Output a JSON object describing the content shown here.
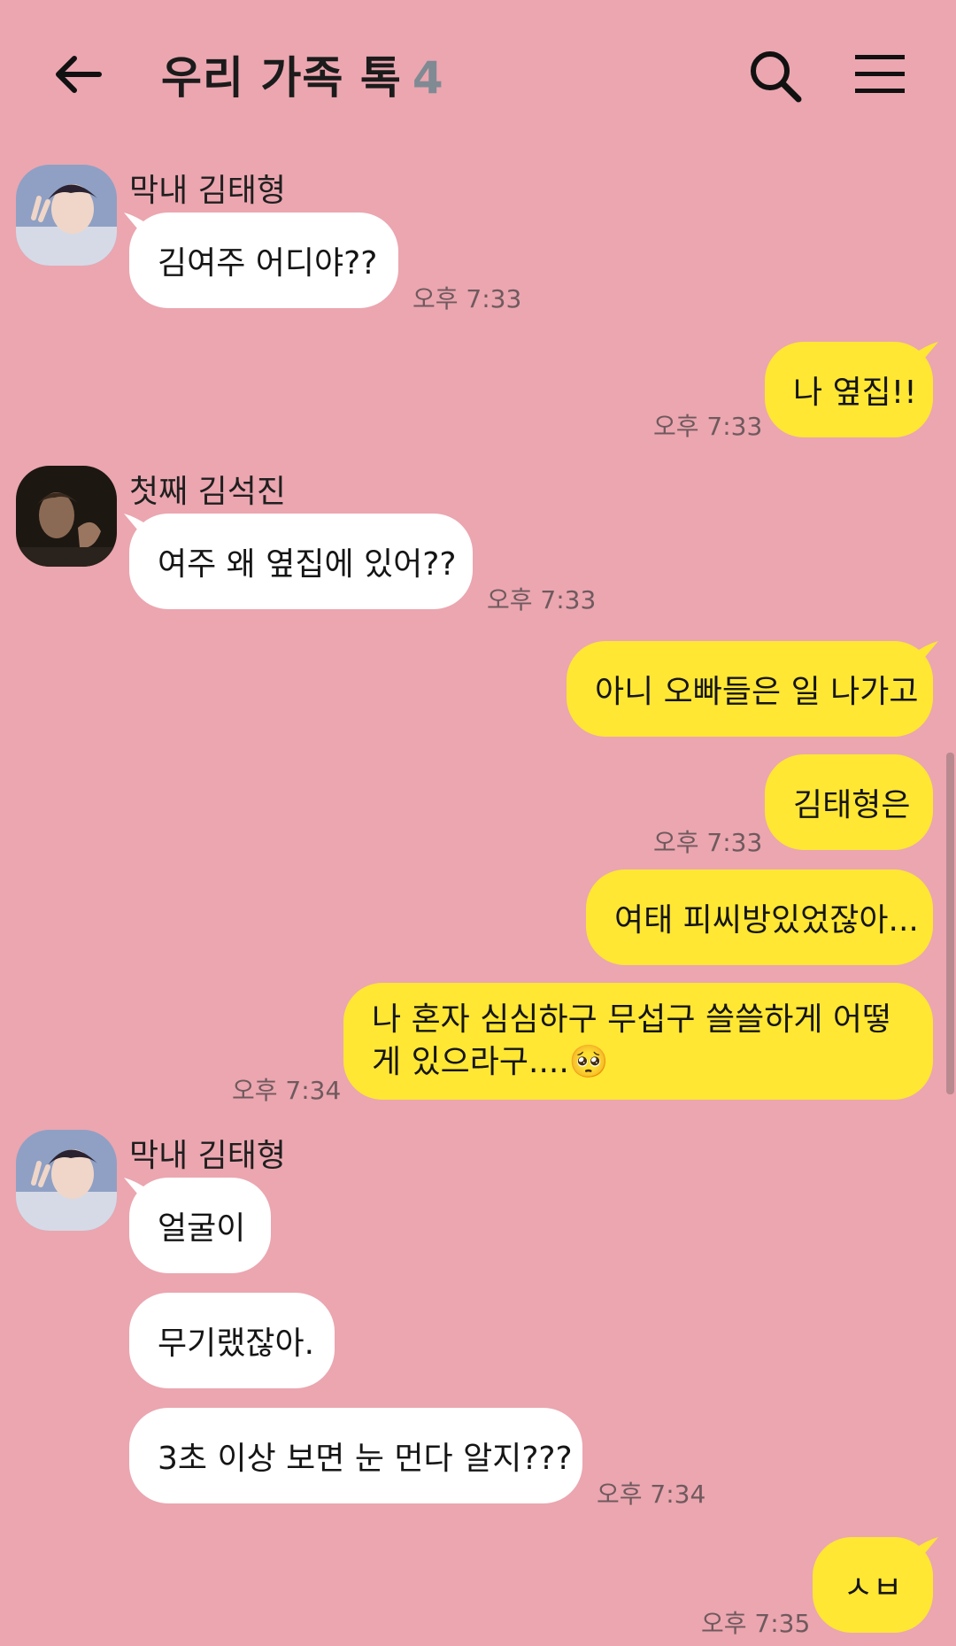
{
  "header": {
    "title": "우리 가족 톡",
    "member_count": "4",
    "back_icon": "back-arrow-icon",
    "search_icon": "search-icon",
    "menu_icon": "hamburger-menu-icon"
  },
  "colors": {
    "background": "#eba6b0",
    "incoming_bubble": "#ffffff",
    "outgoing_bubble": "#ffe734"
  },
  "messages": [
    {
      "sender": "막내 김태형",
      "text": "김여주 어디야??",
      "time": "오후 7:33"
    },
    {
      "sender": "me",
      "text": "나 옆집!!",
      "time": "오후 7:33"
    },
    {
      "sender": "첫째 김석진",
      "text": "여주 왜 옆집에 있어??",
      "time": "오후 7:33"
    },
    {
      "sender": "me",
      "text": "아니 오빠들은 일 나가고"
    },
    {
      "sender": "me",
      "text": "김태형은",
      "time": "오후 7:33"
    },
    {
      "sender": "me",
      "text": "여태 피씨방있었잖아..."
    },
    {
      "sender": "me",
      "text": "나 혼자 심심하구 무섭구 쓸쓸하게 어떻게 있으라구....🥺",
      "time": "오후 7:34"
    },
    {
      "sender": "막내 김태형",
      "text": "얼굴이"
    },
    {
      "sender": "막내 김태형",
      "text": "무기랬잖아."
    },
    {
      "sender": "막내 김태형",
      "text": "3초 이상 보면 눈 먼다 알지???",
      "time": "오후 7:34"
    },
    {
      "sender": "me",
      "text": "ㅅㅂ",
      "time": "오후 7:35"
    }
  ]
}
